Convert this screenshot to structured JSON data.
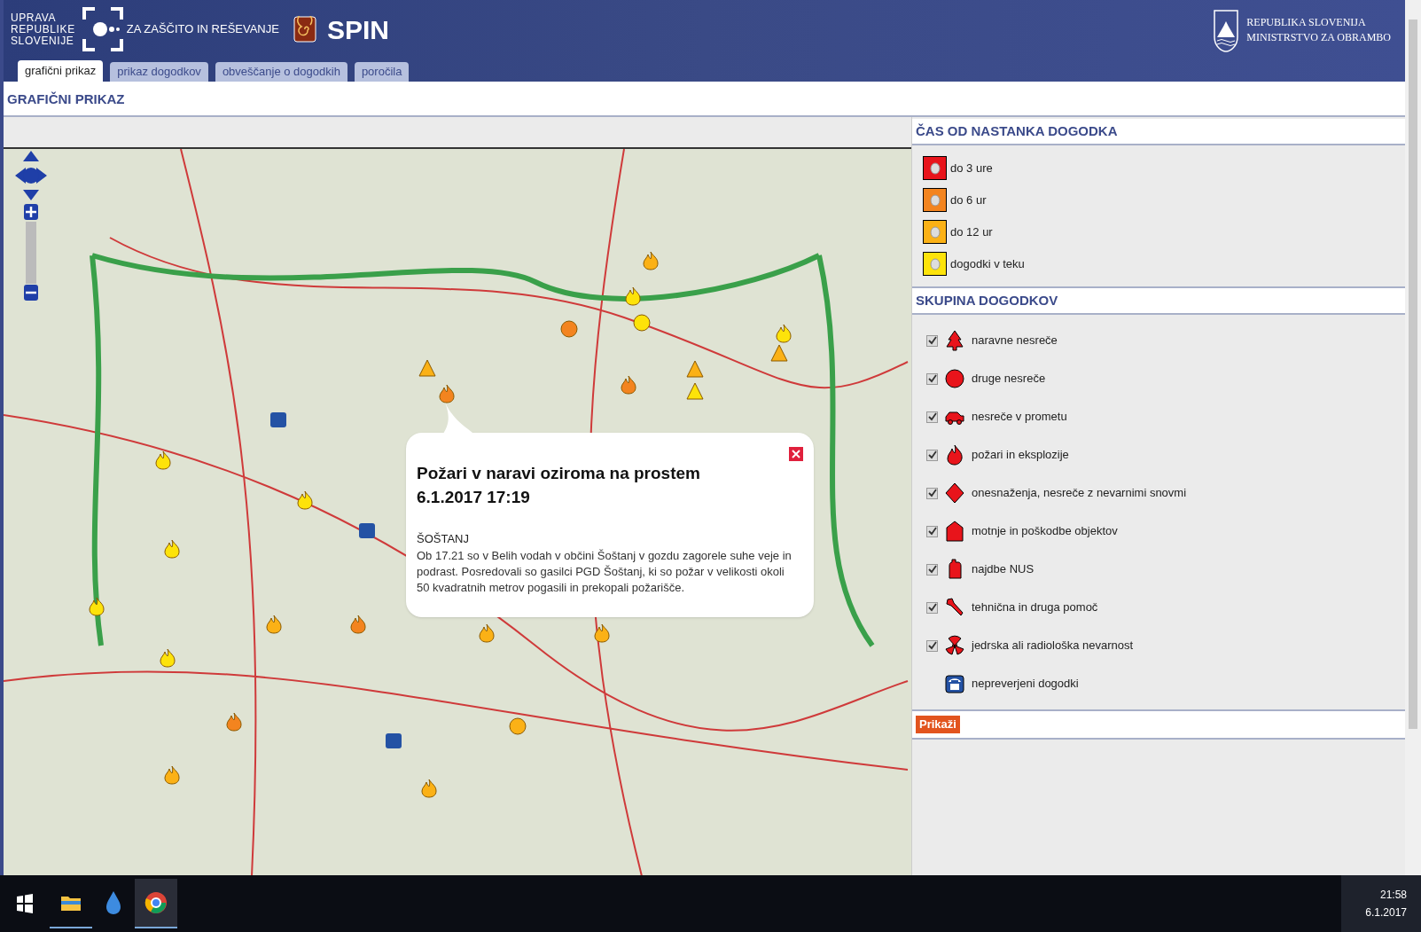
{
  "header": {
    "agency_lines": [
      "UPRAVA",
      "REPUBLIKE",
      "SLOVENIJE"
    ],
    "agency_tagline": "ZA ZAŠČITO IN REŠEVANJE",
    "app_name": "SPIN",
    "ministry_lines": [
      "REPUBLIKA SLOVENIJA",
      "MINISTRSTVO ZA OBRAMBO"
    ]
  },
  "tabs": [
    {
      "label": "grafični prikaz",
      "selected": true
    },
    {
      "label": "prikaz dogodkov",
      "selected": false
    },
    {
      "label": "obveščanje o dogodkih",
      "selected": false
    },
    {
      "label": "poročila",
      "selected": false
    }
  ],
  "page_title": "GRAFIČNI PRIKAZ",
  "map": {
    "popup": {
      "title": "Požari v naravi oziroma na prostem",
      "datetime": "6.1.2017 17:19",
      "place": "ŠOŠTANJ",
      "text": "Ob 17.21 so v Belih vodah v občini Šoštanj v gozdu zagorele suhe veje in podrast. Posredovali so gasilci PGD Šoštanj, ki so požar v velikosti okoli 50 kvadratnih metrov pogasili in prekopali požarišče."
    }
  },
  "time_legend": {
    "title": "ČAS OD NASTANKA DOGODKA",
    "items": [
      {
        "label": "do 3 ure",
        "color": "#e8141b"
      },
      {
        "label": "do 6 ur",
        "color": "#f3841f"
      },
      {
        "label": "do 12 ur",
        "color": "#fbb116"
      },
      {
        "label": "dogodki v teku",
        "color": "#fde30a"
      }
    ]
  },
  "event_groups": {
    "title": "SKUPINA DOGODKOV",
    "items": [
      {
        "label": "naravne nesreče",
        "kind": "checkbox",
        "checked": true
      },
      {
        "label": "druge nesreče",
        "kind": "checkbox",
        "checked": true
      },
      {
        "label": "nesreče v prometu",
        "kind": "checkbox",
        "checked": true
      },
      {
        "label": "požari in eksplozije",
        "kind": "checkbox",
        "checked": true
      },
      {
        "label": "onesnaženja, nesreče z nevarnimi snovmi",
        "kind": "checkbox",
        "checked": true
      },
      {
        "label": "motnje in poškodbe objektov",
        "kind": "checkbox",
        "checked": true
      },
      {
        "label": "najdbe NUS",
        "kind": "checkbox",
        "checked": true
      },
      {
        "label": "tehnična in druga pomoč",
        "kind": "checkbox",
        "checked": true
      },
      {
        "label": "jedrska ali radiološka nevarnost",
        "kind": "checkbox",
        "checked": true
      },
      {
        "label": "nepreverjeni dogodki",
        "kind": "plain"
      }
    ]
  },
  "show_button": "Prikaži",
  "taskbar": {
    "time": "21:58",
    "date": "6.1.2017"
  }
}
